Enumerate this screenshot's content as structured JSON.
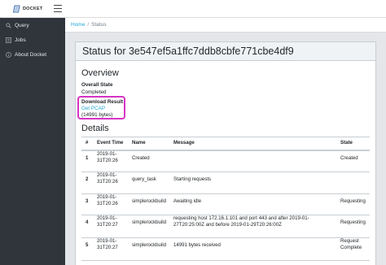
{
  "app": {
    "logo_text": "DOCKET"
  },
  "sidebar": {
    "items": [
      {
        "label": "Query",
        "icon": "search-icon"
      },
      {
        "label": "Jobs",
        "icon": "list-icon"
      },
      {
        "label": "About Docket",
        "icon": "info-icon"
      }
    ]
  },
  "breadcrumb": {
    "home": "Home",
    "separator": "/",
    "current": "Status"
  },
  "page": {
    "title": "Status for 3e547ef5a1ffc7ddb8cbfe771cbe4df9",
    "overview_heading": "Overview",
    "overall_state_label": "Overall State",
    "overall_state_value": "Completed",
    "download_label": "Download Result",
    "download_link": "Get PCAP",
    "download_size": "(14991 bytes)",
    "details_heading": "Details"
  },
  "details_table": {
    "headers": [
      "#",
      "Event Time",
      "Name",
      "Message",
      "State"
    ],
    "rows": [
      {
        "num": "1",
        "time": [
          "2019-01-",
          "31T20:26"
        ],
        "name": "Created",
        "message": [
          ""
        ],
        "state": [
          "Created"
        ]
      },
      {
        "num": "2",
        "time": [
          "2019-01-",
          "31T20:26"
        ],
        "name": "query_task",
        "message": [
          "Starting requests"
        ],
        "state": [
          ""
        ]
      },
      {
        "num": "3",
        "time": [
          "2019-01-",
          "31T20:26"
        ],
        "name": "simplerockbuild",
        "message": [
          "Awaiting idle"
        ],
        "state": [
          "Requesting"
        ]
      },
      {
        "num": "4",
        "time": [
          "2019-01-",
          "31T20:27"
        ],
        "name": "simplerockbuild",
        "message": [
          "requesting host 172.16.1.101 and port 443 and after 2019-01-",
          "27T20:25:00Z and before 2019-01-29T20:26:00Z"
        ],
        "state": [
          "Requesting"
        ]
      },
      {
        "num": "5",
        "time": [
          "2019-01-",
          "31T20:27"
        ],
        "name": "simplerockbuild",
        "message": [
          "14991 bytes received"
        ],
        "state": [
          "Request",
          "Complete"
        ]
      }
    ]
  },
  "colors": {
    "sidebar_bg": "#2f353a",
    "link": "#20a8d8",
    "highlight": "#d633c4",
    "page_bg": "#e4e6e9"
  }
}
